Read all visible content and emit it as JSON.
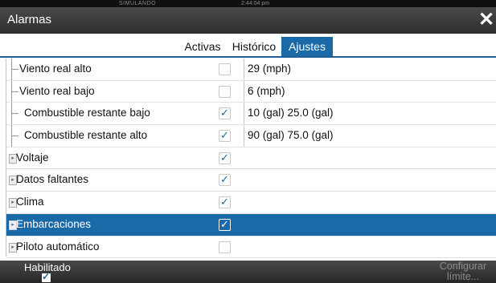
{
  "status_bar": {
    "simulating": "SIMULANDO",
    "time": "2:44:04 pm"
  },
  "window": {
    "title": "Alarmas",
    "close_glyph": "✕"
  },
  "tabs": [
    {
      "label": "Activas",
      "selected": false
    },
    {
      "label": "Histórico",
      "selected": false
    },
    {
      "label": "Ajustes",
      "selected": true
    }
  ],
  "rows": [
    {
      "label": "Viento real alto",
      "checked": false,
      "value": "29 (mph)"
    },
    {
      "label": "Viento real bajo",
      "checked": false,
      "value": "6 (mph)"
    },
    {
      "label": "Combustible restante bajo",
      "checked": true,
      "value": "10 (gal)  25.0 (gal)"
    },
    {
      "label": "Combustible restante alto",
      "checked": true,
      "value": "90 (gal)  75.0 (gal)"
    },
    {
      "label": "Voltaje",
      "checked": true,
      "value": ""
    },
    {
      "label": "Datos faltantes",
      "checked": true,
      "value": ""
    },
    {
      "label": "Clima",
      "checked": true,
      "value": ""
    },
    {
      "label": "Embarcaciones",
      "checked": true,
      "value": ""
    },
    {
      "label": "Piloto automático",
      "checked": false,
      "value": ""
    }
  ],
  "footer": {
    "enabled_label": "Habilitado",
    "enabled_checked": true,
    "configure_line1": "Configurar",
    "configure_line2": "límite..."
  },
  "colors": {
    "accent": "#1a6aa8",
    "titlebar": "#3a3a3a"
  }
}
